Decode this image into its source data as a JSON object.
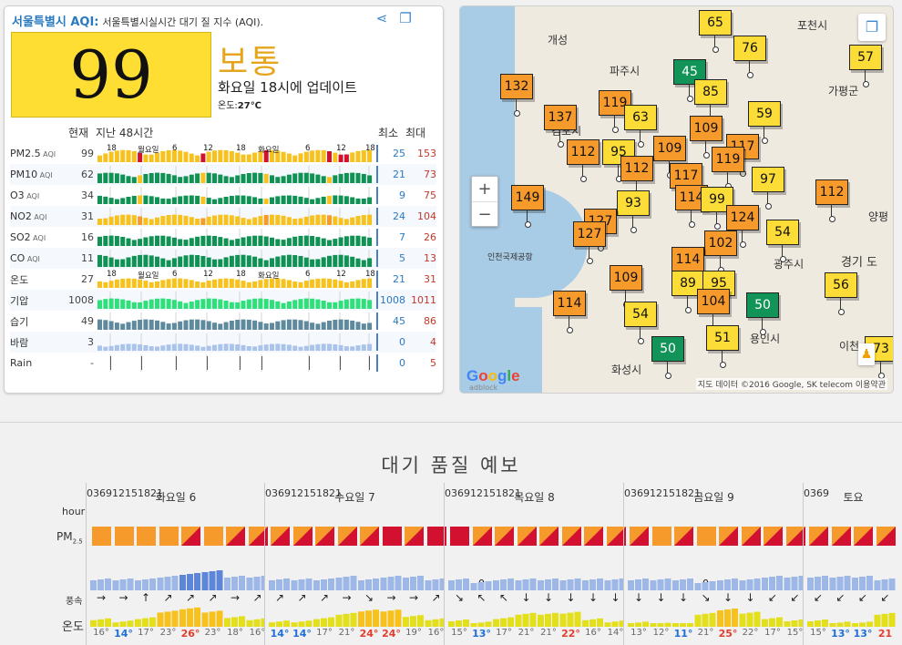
{
  "panel": {
    "city": "서울특별시 AQI",
    "colon": ":",
    "subtitle": "서울특별시실시간 대기 질 지수 (AQI).",
    "share_icon": "share-icon",
    "layers_icon": "layers-icon",
    "aqi": "99",
    "level": "보통",
    "updated": "화요일 18시에 업데이트",
    "temp_label": "온도:",
    "temp_value": "27℃",
    "hdr_current": "현재",
    "hdr_last": "지난 48시간",
    "hdr_min": "최소",
    "hdr_max": "최대",
    "axis_ticks": [
      "18",
      "월요일",
      "6",
      "12",
      "18",
      "화요일",
      "6",
      "12",
      "18"
    ],
    "rows": [
      {
        "label": "PM2.5",
        "unit": "AQI",
        "current": "99",
        "min": "25",
        "max": "153",
        "color": "#f8c21e",
        "peak": "#d2102f",
        "level": 0.7
      },
      {
        "label": "PM10",
        "unit": "AQI",
        "current": "62",
        "min": "21",
        "max": "73",
        "color": "#109255",
        "peak": "#f8c21e",
        "level": 0.6
      },
      {
        "label": "O3",
        "unit": "AQI",
        "current": "34",
        "min": "9",
        "max": "75",
        "color": "#109255",
        "peak": "#f8c21e",
        "level": 0.5
      },
      {
        "label": "NO2",
        "unit": "AQI",
        "current": "31",
        "min": "24",
        "max": "104",
        "color": "#f8c21e",
        "peak": "#f79a2c",
        "level": 0.6
      },
      {
        "label": "SO2",
        "unit": "AQI",
        "current": "16",
        "min": "7",
        "max": "26",
        "color": "#109255",
        "peak": "#109255",
        "level": 0.6
      },
      {
        "label": "CO",
        "unit": "AQI",
        "current": "11",
        "min": "5",
        "max": "13",
        "color": "#109255",
        "peak": "#109255",
        "level": 0.7
      },
      {
        "label": "온도",
        "unit": "",
        "current": "27",
        "min": "21",
        "max": "31",
        "color": "#f8c21e",
        "peak": "#f8c21e",
        "level": 0.55
      },
      {
        "label": "기압",
        "unit": "",
        "current": "1008",
        "min": "1008",
        "max": "1011",
        "color": "#2ee07a",
        "peak": "#2ee07a",
        "level": 0.6
      },
      {
        "label": "습기",
        "unit": "",
        "current": "49",
        "min": "45",
        "max": "86",
        "color": "#5f8a9e",
        "peak": "#5f8a9e",
        "level": 0.6
      },
      {
        "label": "바람",
        "unit": "",
        "current": "3",
        "min": "0",
        "max": "4",
        "color": "#a9c3ea",
        "peak": "#a9c3ea",
        "level": 0.4
      },
      {
        "label": "Rain",
        "unit": "",
        "current": "-",
        "min": "0",
        "max": "5",
        "color": "#444",
        "peak": "#444",
        "level": 0
      }
    ]
  },
  "map": {
    "labels": [
      "포천시",
      "개성",
      "파주시",
      "가평군",
      "김포시",
      "양평",
      "경기 도",
      "인천국제공항",
      "광주시",
      "용인시",
      "화성시",
      "이천"
    ],
    "markers": [
      {
        "v": "65",
        "c": "y"
      },
      {
        "v": "76",
        "c": "y"
      },
      {
        "v": "45",
        "c": "g"
      },
      {
        "v": "57",
        "c": "y"
      },
      {
        "v": "85",
        "c": "y"
      },
      {
        "v": "132",
        "c": "o"
      },
      {
        "v": "119",
        "c": "o"
      },
      {
        "v": "63",
        "c": "y"
      },
      {
        "v": "59",
        "c": "y"
      },
      {
        "v": "137",
        "c": "o"
      },
      {
        "v": "109",
        "c": "o"
      },
      {
        "v": "112",
        "c": "o"
      },
      {
        "v": "95",
        "c": "y"
      },
      {
        "v": "109",
        "c": "o"
      },
      {
        "v": "117",
        "c": "o"
      },
      {
        "v": "119",
        "c": "o"
      },
      {
        "v": "112",
        "c": "o"
      },
      {
        "v": "117",
        "c": "o"
      },
      {
        "v": "97",
        "c": "y"
      },
      {
        "v": "149",
        "c": "o"
      },
      {
        "v": "112",
        "c": "o"
      },
      {
        "v": "93",
        "c": "y"
      },
      {
        "v": "114",
        "c": "o"
      },
      {
        "v": "99",
        "c": "y"
      },
      {
        "v": "127",
        "c": "o"
      },
      {
        "v": "124",
        "c": "o"
      },
      {
        "v": "127",
        "c": "o"
      },
      {
        "v": "54",
        "c": "y"
      },
      {
        "v": "102",
        "c": "o"
      },
      {
        "v": "114",
        "c": "o"
      },
      {
        "v": "109",
        "c": "o"
      },
      {
        "v": "89",
        "c": "y"
      },
      {
        "v": "95",
        "c": "y"
      },
      {
        "v": "114",
        "c": "o"
      },
      {
        "v": "56",
        "c": "y"
      },
      {
        "v": "104",
        "c": "o"
      },
      {
        "v": "50",
        "c": "g"
      },
      {
        "v": "54",
        "c": "y"
      },
      {
        "v": "51",
        "c": "y"
      },
      {
        "v": "50",
        "c": "g"
      },
      {
        "v": "73",
        "c": "y"
      }
    ],
    "zoom_in": "+",
    "zoom_out": "−",
    "google": "Google",
    "adblock": "adblock",
    "attribution": "지도 데이터 ©2016 Google, SK telecom   이용약관"
  },
  "forecast": {
    "title": "대기 품질 예보",
    "hour_label": "hour",
    "pm_label": "PM",
    "pm_sub": "2.5",
    "wind_label": "풍속",
    "temp_label": "온도",
    "days": [
      {
        "name": "화요일 6",
        "hours": [
          "0",
          "3",
          "6",
          "9",
          "12",
          "15",
          "18",
          "21"
        ],
        "pm": [
          "o",
          "o",
          "o",
          "o",
          "or",
          "o",
          "or",
          "or"
        ],
        "wind": [
          "1",
          "1",
          "1",
          "2",
          "3",
          "4",
          "2",
          "2"
        ],
        "dirs": [
          "→",
          "→",
          "↑",
          "↗",
          "↗",
          "↗",
          "→",
          "↗"
        ],
        "temps": [
          "16°",
          "14°",
          "17°",
          "23°",
          "26°",
          "23°",
          "18°",
          "16°"
        ]
      },
      {
        "name": "수요일 7",
        "hours": [
          "0",
          "3",
          "6",
          "9",
          "12",
          "15",
          "18",
          "21"
        ],
        "pm": [
          "or",
          "or",
          "or",
          "or",
          "or",
          "r",
          "or",
          "r"
        ],
        "wind": [
          "1",
          "1",
          "1",
          "2",
          "1",
          "2",
          "2",
          "1"
        ],
        "dirs": [
          "↗",
          "↗",
          "↗",
          "→",
          "↘",
          "→",
          "→",
          "↗"
        ],
        "temps": [
          "14°",
          "14°",
          "17°",
          "21°",
          "24°",
          "24°",
          "19°",
          "16°"
        ]
      },
      {
        "name": "목요일 8",
        "hours": [
          "0",
          "3",
          "6",
          "9",
          "12",
          "15",
          "18",
          "21"
        ],
        "pm": [
          "r",
          "or",
          "or",
          "or",
          "or",
          "or",
          "or",
          "or"
        ],
        "wind": [
          "1",
          "0",
          "1",
          "1",
          "1",
          "1",
          "1",
          "1"
        ],
        "dirs": [
          "↘",
          "↖",
          "↖",
          "↓",
          "↓",
          "↓",
          "↓",
          "↓"
        ],
        "temps": [
          "15°",
          "13°",
          "17°",
          "21°",
          "21°",
          "22°",
          "16°",
          "14°"
        ]
      },
      {
        "name": "금요일 9",
        "hours": [
          "0",
          "3",
          "6",
          "9",
          "12",
          "15",
          "18",
          "21"
        ],
        "pm": [
          "or",
          "o",
          "or",
          "o",
          "or",
          "or",
          "or",
          "or"
        ],
        "wind": [
          "1",
          "1",
          "1",
          "0",
          "1",
          "1",
          "2",
          "2"
        ],
        "dirs": [
          "↓",
          "↓",
          "↓",
          "↘",
          "↓",
          "↓",
          "↙",
          "↙"
        ],
        "temps": [
          "13°",
          "12°",
          "11°",
          "21°",
          "25°",
          "22°",
          "17°",
          "15°"
        ]
      },
      {
        "name": "토요",
        "hours": [
          "0",
          "3",
          "6",
          "9"
        ],
        "pm": [
          "or",
          "or",
          "or",
          "or"
        ],
        "wind": [
          "2",
          "2",
          "2",
          "1"
        ],
        "dirs": [
          "↙",
          "↙",
          "↙",
          "↙"
        ],
        "temps": [
          "15°",
          "13°",
          "13°",
          "21"
        ]
      }
    ]
  }
}
